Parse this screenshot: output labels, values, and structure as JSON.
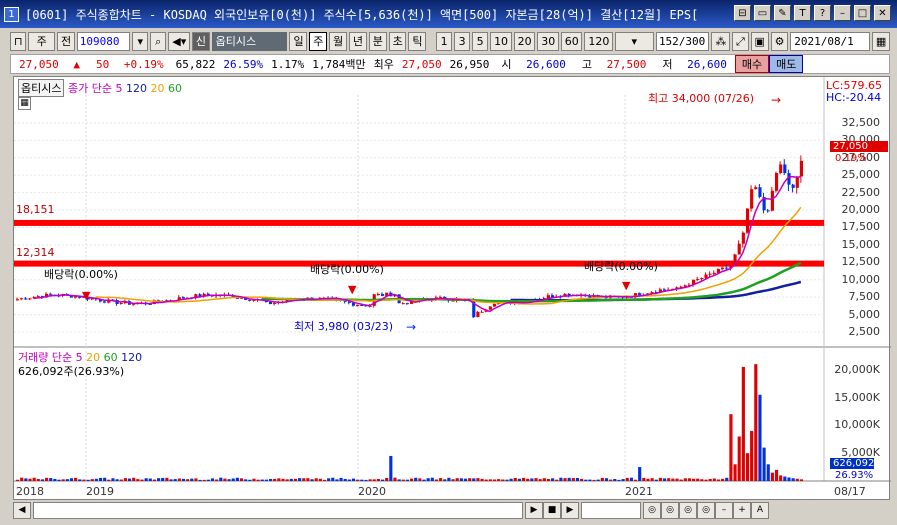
{
  "window": {
    "number": "1",
    "title": "[0601] 주식종합차트 - KOSDAQ 외국인보유[0(천)] 주식수[5,636(천)] 액면[500] 자본금[28(억)] 결산[12월] EPS[",
    "buttons": [
      "⊟",
      "▭",
      "✎",
      "T",
      "?",
      "–",
      "□",
      "✕"
    ]
  },
  "toolbar": {
    "type_select": "주",
    "jeon_btn": "전",
    "code": "109080",
    "shin_label": "신",
    "stock_name": "옵티시스",
    "periods": [
      "일",
      "주",
      "월",
      "년",
      "분",
      "초",
      "틱"
    ],
    "active_period": "주",
    "intervals": [
      "1",
      "3",
      "5",
      "10",
      "20",
      "30",
      "60",
      "120"
    ],
    "count": "152",
    "count_total": "/300",
    "date": "2021/08/1"
  },
  "quote": {
    "price": "27,050",
    "arrow": "▲",
    "change": "50",
    "change_pct": "+0.19%",
    "volume": "65,822",
    "turnover_pct": "26.59%",
    "ratio": "1.17%",
    "amount": "1,784백만",
    "best_label": "최우",
    "best_ask": "27,050",
    "best_bid": "26,950",
    "open_label": "시",
    "open": "26,600",
    "high_label": "고",
    "high": "27,500",
    "low_label": "저",
    "low": "26,600",
    "buy": "매수",
    "sell": "매도"
  },
  "price_panel": {
    "stock_label": "옵티시스",
    "legend_prefix": "종가 단순",
    "ma": [
      "5",
      "120",
      "20",
      "60"
    ],
    "lc": "LC:579.65",
    "hc": "HC:-20.44",
    "current_price": "27,050",
    "current_pct": "0.19%",
    "y_ticks": [
      "32,500",
      "30,000",
      "27,500",
      "25,000",
      "22,500",
      "20,000",
      "17,500",
      "15,000",
      "12,500",
      "10,000",
      "7,500",
      "5,000",
      "2,500"
    ],
    "hline1": "18,151",
    "hline2": "12,314",
    "annotations": {
      "high": "최고 34,000 (07/26)",
      "low": "최저 3,980 (03/23)",
      "div1": "배당락(0.00%)",
      "div2": "배당락(0.00%)",
      "div3": "배당락(0.00%)"
    }
  },
  "volume_panel": {
    "legend_prefix": "거래량 단순",
    "ma": [
      "5",
      "20",
      "60",
      "120"
    ],
    "current": "626,092주(26.93%)",
    "y_ticks": [
      "20,000K",
      "15,000K",
      "10,000K",
      "5,000K"
    ],
    "current_tag": "626,092",
    "current_pct": "26.93%"
  },
  "x_axis": [
    "2018",
    "2019",
    "2020",
    "2021",
    "08/17"
  ],
  "colors": {
    "up": "#e00000",
    "down": "#0030e0",
    "ma5": "#c000c0",
    "ma20": "#f0a000",
    "ma60": "#20a020",
    "ma120": "#1020a0",
    "hline": "#ff0000"
  }
}
